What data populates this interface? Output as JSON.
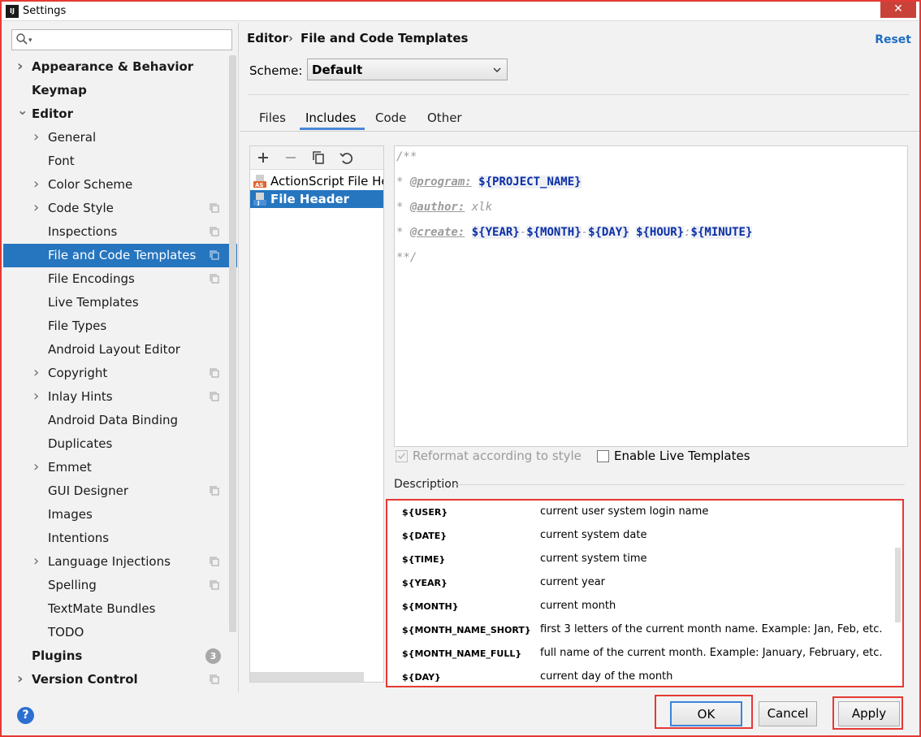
{
  "window": {
    "title": "Settings",
    "app_icon_text": "IJ",
    "close_glyph": "✕"
  },
  "search": {
    "placeholder": "",
    "icon": "search-icon"
  },
  "sidebar": {
    "items": [
      {
        "label": "Appearance & Behavior",
        "bold": true,
        "arrow": "right",
        "indent": 0
      },
      {
        "label": "Keymap",
        "bold": true,
        "arrow": "none",
        "indent": 0
      },
      {
        "label": "Editor",
        "bold": true,
        "arrow": "down",
        "indent": 0
      },
      {
        "label": "General",
        "arrow": "right",
        "indent": 1
      },
      {
        "label": "Font",
        "arrow": "none",
        "indent": 1
      },
      {
        "label": "Color Scheme",
        "arrow": "right",
        "indent": 1
      },
      {
        "label": "Code Style",
        "arrow": "right",
        "indent": 1,
        "copy": true
      },
      {
        "label": "Inspections",
        "arrow": "none",
        "indent": 1,
        "copy": true
      },
      {
        "label": "File and Code Templates",
        "arrow": "none",
        "indent": 1,
        "copy": true,
        "selected": true
      },
      {
        "label": "File Encodings",
        "arrow": "none",
        "indent": 1,
        "copy": true
      },
      {
        "label": "Live Templates",
        "arrow": "none",
        "indent": 1
      },
      {
        "label": "File Types",
        "arrow": "none",
        "indent": 1
      },
      {
        "label": "Android Layout Editor",
        "arrow": "none",
        "indent": 1
      },
      {
        "label": "Copyright",
        "arrow": "right",
        "indent": 1,
        "copy": true
      },
      {
        "label": "Inlay Hints",
        "arrow": "right",
        "indent": 1,
        "copy": true
      },
      {
        "label": "Android Data Binding",
        "arrow": "none",
        "indent": 1
      },
      {
        "label": "Duplicates",
        "arrow": "none",
        "indent": 1
      },
      {
        "label": "Emmet",
        "arrow": "right",
        "indent": 1
      },
      {
        "label": "GUI Designer",
        "arrow": "none",
        "indent": 1,
        "copy": true
      },
      {
        "label": "Images",
        "arrow": "none",
        "indent": 1
      },
      {
        "label": "Intentions",
        "arrow": "none",
        "indent": 1
      },
      {
        "label": "Language Injections",
        "arrow": "right",
        "indent": 1,
        "copy": true
      },
      {
        "label": "Spelling",
        "arrow": "none",
        "indent": 1,
        "copy": true
      },
      {
        "label": "TextMate Bundles",
        "arrow": "none",
        "indent": 1
      },
      {
        "label": "TODO",
        "arrow": "none",
        "indent": 1
      },
      {
        "label": "Plugins",
        "bold": true,
        "arrow": "none",
        "indent": 0,
        "badge": "3"
      },
      {
        "label": "Version Control",
        "bold": true,
        "arrow": "right",
        "indent": 0,
        "copy": true
      }
    ]
  },
  "header": {
    "breadcrumb_root": "Editor",
    "breadcrumb_sep": "›",
    "breadcrumb_current": "File and Code Templates",
    "reset_label": "Reset"
  },
  "scheme": {
    "label": "Scheme:",
    "value": "Default"
  },
  "tabs": [
    {
      "label": "Files",
      "active": false
    },
    {
      "label": "Includes",
      "active": true
    },
    {
      "label": "Code",
      "active": false
    },
    {
      "label": "Other",
      "active": false
    }
  ],
  "templates": {
    "items": [
      {
        "label": "ActionScript File Header",
        "icon": "actionscript-file-icon",
        "selected": false
      },
      {
        "label": "File Header",
        "icon": "java-file-icon",
        "selected": true
      }
    ]
  },
  "code": {
    "line1": "/**",
    "line2_prefix": "* ",
    "line2_tag": "@program:",
    "line2_var": "${PROJECT_NAME}",
    "line3_prefix": "* ",
    "line3_tag": "@author:",
    "line3_val": "xlk",
    "line4_prefix": "* ",
    "line4_tag": "@create:",
    "line4_year": "${YEAR}",
    "line4_month": "${MONTH}",
    "line4_day": "${DAY}",
    "line4_hour": "${HOUR}",
    "line4_minute": "${MINUTE}",
    "dash": "-",
    "colon": ":",
    "line5": "**/"
  },
  "options": {
    "reformat_label": "Reformat according to style",
    "reformat_checked": true,
    "live_templates_label": "Enable Live Templates",
    "live_templates_checked": false
  },
  "description": {
    "label": "Description",
    "rows": [
      {
        "var": "${USER}",
        "text": "current user system login name"
      },
      {
        "var": "${DATE}",
        "text": "current system date"
      },
      {
        "var": "${TIME}",
        "text": "current system time"
      },
      {
        "var": "${YEAR}",
        "text": "current year"
      },
      {
        "var": "${MONTH}",
        "text": "current month"
      },
      {
        "var": "${MONTH_NAME_SHORT}",
        "text": "first 3 letters of the current month name. Example: Jan, Feb, etc."
      },
      {
        "var": "${MONTH_NAME_FULL}",
        "text": "full name of the current month. Example: January, February, etc."
      },
      {
        "var": "${DAY}",
        "text": "current day of the month"
      }
    ]
  },
  "footer": {
    "help_label": "?",
    "ok_label": "OK",
    "cancel_label": "Cancel",
    "apply_label": "Apply"
  },
  "colors": {
    "selection": "#2675bf",
    "highlight_border": "#e53935",
    "link": "#1f6dc2",
    "variable": "#0b2fa6"
  }
}
